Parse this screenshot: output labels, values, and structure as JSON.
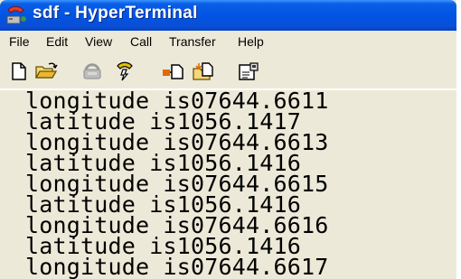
{
  "window": {
    "title": "sdf - HyperTerminal",
    "app_icon": "hyperterminal-icon"
  },
  "menu": {
    "items": [
      {
        "label": "File"
      },
      {
        "label": "Edit"
      },
      {
        "label": "View"
      },
      {
        "label": "Call"
      },
      {
        "label": "Transfer"
      },
      {
        "label": "Help"
      }
    ]
  },
  "toolbar": {
    "buttons": [
      {
        "icon": "new-icon"
      },
      {
        "icon": "open-icon"
      },
      {
        "icon": "connect-icon"
      },
      {
        "icon": "disconnect-icon"
      },
      {
        "icon": "send-icon"
      },
      {
        "icon": "receive-icon"
      },
      {
        "icon": "properties-icon"
      }
    ]
  },
  "terminal": {
    "lines": [
      "longitude is07644.6611",
      "latitude is1056.1417",
      "longitude is07644.6613",
      "latitude is1056.1416",
      "longitude is07644.6615",
      "latitude is1056.1416",
      "longitude is07644.6616",
      "latitude is1056.1416",
      "longitude is07644.6617"
    ]
  }
}
